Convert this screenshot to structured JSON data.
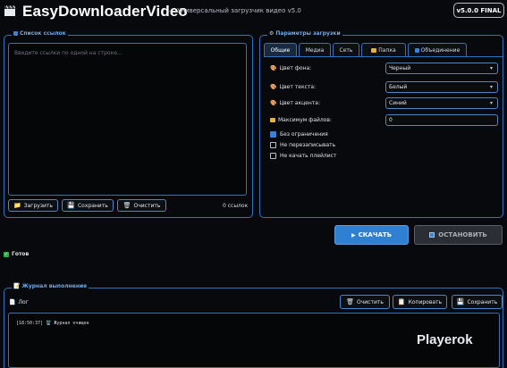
{
  "header": {
    "title": "EasyDownloaderVideo",
    "subtitle": "— Универсальный загрузчик видео v5.0",
    "version": "v5.0.0 FINAL"
  },
  "links": {
    "group_title": "Список ссылок",
    "placeholder": "Введите ссылки по одной на строке...",
    "buttons": {
      "load": "Загрузить",
      "save": "Сохранить",
      "clear": "Очистить"
    },
    "count": "0 ссылок"
  },
  "settings": {
    "group_title": "Параметры загрузки",
    "tabs": [
      "Общие",
      "Медиа",
      "Сеть",
      "Папка",
      "Объединение"
    ],
    "active_tab": "Общие",
    "fields": {
      "bg_color": {
        "label": "Цвет фона:",
        "value": "Черный"
      },
      "text_color": {
        "label": "Цвет текста:",
        "value": "Белый"
      },
      "accent_color": {
        "label": "Цвет акцента:",
        "value": "Синий"
      },
      "max_files": {
        "label": "Максимум файлов:",
        "value": "0"
      }
    },
    "checkboxes": [
      {
        "label": "Без ограничения",
        "checked": true
      },
      {
        "label": "Не перезаписывать",
        "checked": false
      },
      {
        "label": "Не качать плейлист",
        "checked": false
      }
    ]
  },
  "actions": {
    "download": "СКАЧАТЬ",
    "stop": "ОСТАНОВИТЬ"
  },
  "status": {
    "text": "Готов"
  },
  "journal": {
    "group_title": "Журнал выполнения",
    "log_label": "Лог",
    "buttons": {
      "clear": "Очистить",
      "copy": "Копировать",
      "save": "Сохранить"
    },
    "lines": [
      "[18:50:37] 🗑️ Журнал очищен"
    ]
  },
  "watermark": "Playerok",
  "colors": {
    "accent": "#2f74c2",
    "button_primary": "#2f7fd2",
    "background": "#08090c",
    "status_ok": "#2eae4a"
  },
  "icons": {
    "logo": "clapperboard-icon",
    "list": "clipboard-icon",
    "settings": "gear-icon",
    "load": "folder-icon",
    "save": "floppy-icon",
    "clear": "trash-icon",
    "download": "play-icon",
    "stop": "stop-icon",
    "status": "check-icon",
    "journal": "notepad-icon",
    "log": "document-icon",
    "copy": "copy-icon"
  }
}
